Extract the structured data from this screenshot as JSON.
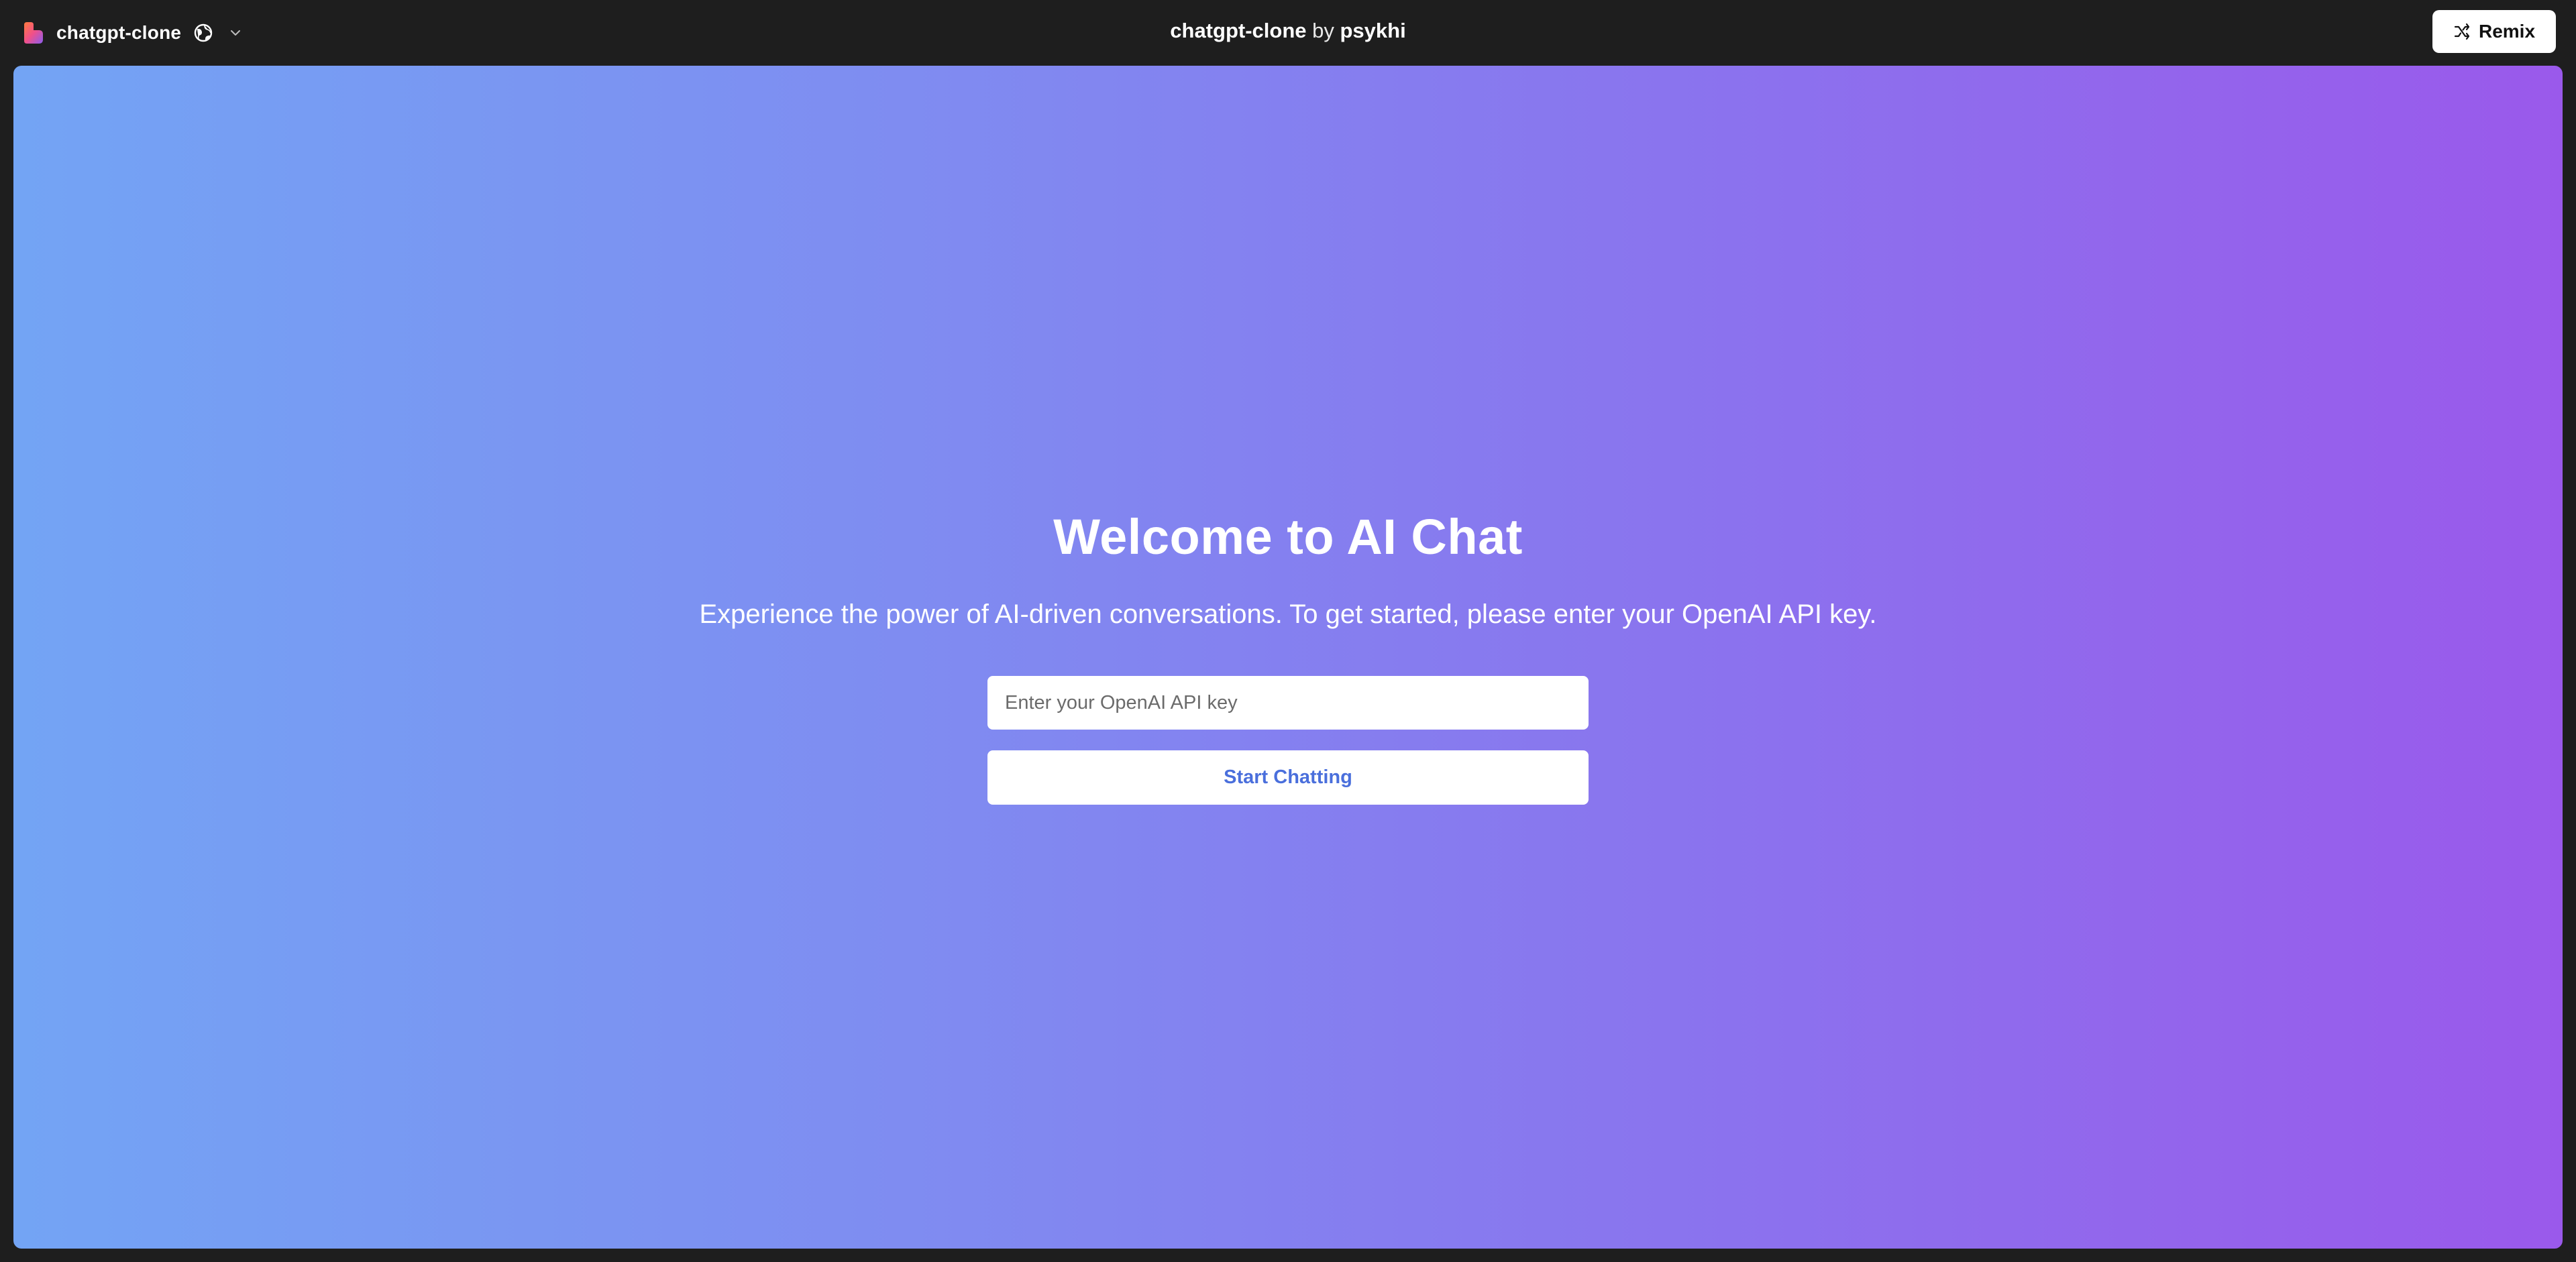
{
  "topbar": {
    "project_name": "chatgpt-clone",
    "title_project": "chatgpt-clone",
    "title_by": "by",
    "title_author": "psykhi",
    "remix_label": "Remix",
    "icons": {
      "logo": "glitch-logo-icon",
      "visibility": "globe-icon",
      "menu": "chevron-down-icon",
      "remix": "shuffle-icon"
    }
  },
  "main": {
    "heading": "Welcome to AI Chat",
    "subtitle": "Experience the power of AI-driven conversations. To get started, please enter your OpenAI API key.",
    "api_key_input": {
      "value": "",
      "placeholder": "Enter your OpenAI API key"
    },
    "start_button_label": "Start Chatting"
  },
  "colors": {
    "topbar_bg": "#1e1e1e",
    "gradient_start": "#73a4f4",
    "gradient_end": "#9a59eb",
    "button_text": "#4a6fdc"
  }
}
